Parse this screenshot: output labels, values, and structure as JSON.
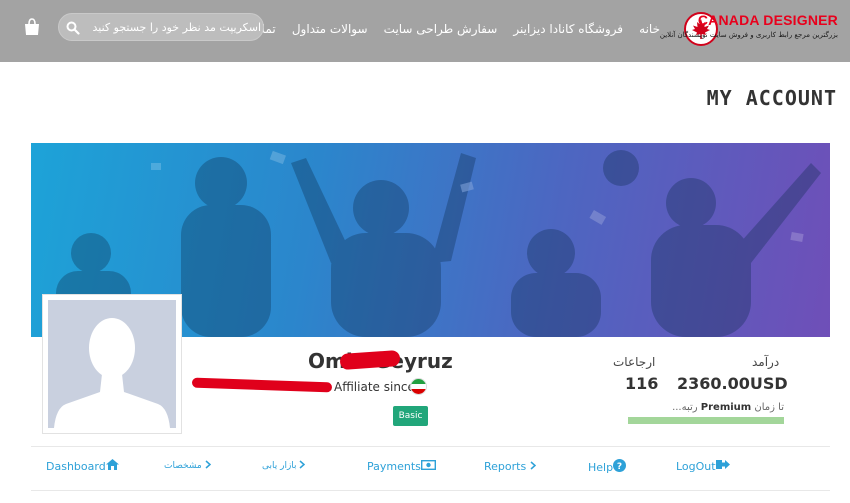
{
  "header": {
    "logo": {
      "title_part1": "CANADA",
      "title_part2": "DESIGNER",
      "subtitle": "بزرگترین مرجع رابط کاربری و فروش سایت نویسندگان آنلاین"
    },
    "nav": [
      {
        "label": "خانه"
      },
      {
        "label": "فروشگاه کانادا دیزاینر"
      },
      {
        "label": "سفارش طراحی سایت"
      },
      {
        "label": "سوالات متداول"
      },
      {
        "label": "تماس با ما"
      }
    ],
    "search": {
      "placeholder": "اسکریپت مد نظر خود را جستجو کنید"
    }
  },
  "page": {
    "title": "MY ACCOUNT"
  },
  "profile": {
    "name": "Omid Geyruz",
    "affiliate_label": "Affiliate since",
    "badge": "Basic"
  },
  "stats": {
    "income_label": "درآمد",
    "income_value": "2360.00USD",
    "referrals_label": "ارجاعات",
    "referrals_value": "116",
    "premium_prefix": "تا زمان",
    "premium_word": "Premium",
    "premium_suffix": "رتبه...",
    "progress_fraction": 1.0
  },
  "tabs": [
    {
      "label": "Dashboard",
      "icon": "home-icon"
    },
    {
      "label": "مشخصات",
      "icon": "chevron-right-icon"
    },
    {
      "label": "بازار یابی",
      "icon": "chevron-right-icon"
    },
    {
      "label": "Payments",
      "icon": "money-icon"
    },
    {
      "label": "Reports",
      "icon": "chevron-right-icon"
    },
    {
      "label": "Help",
      "icon": "question-icon"
    },
    {
      "label": "LogOut",
      "icon": "logout-icon"
    }
  ],
  "colors": {
    "header_bg": "#a3a3a3",
    "accent": "#2ea1d8",
    "badge": "#21a67a",
    "logo_red": "#e8001c"
  }
}
